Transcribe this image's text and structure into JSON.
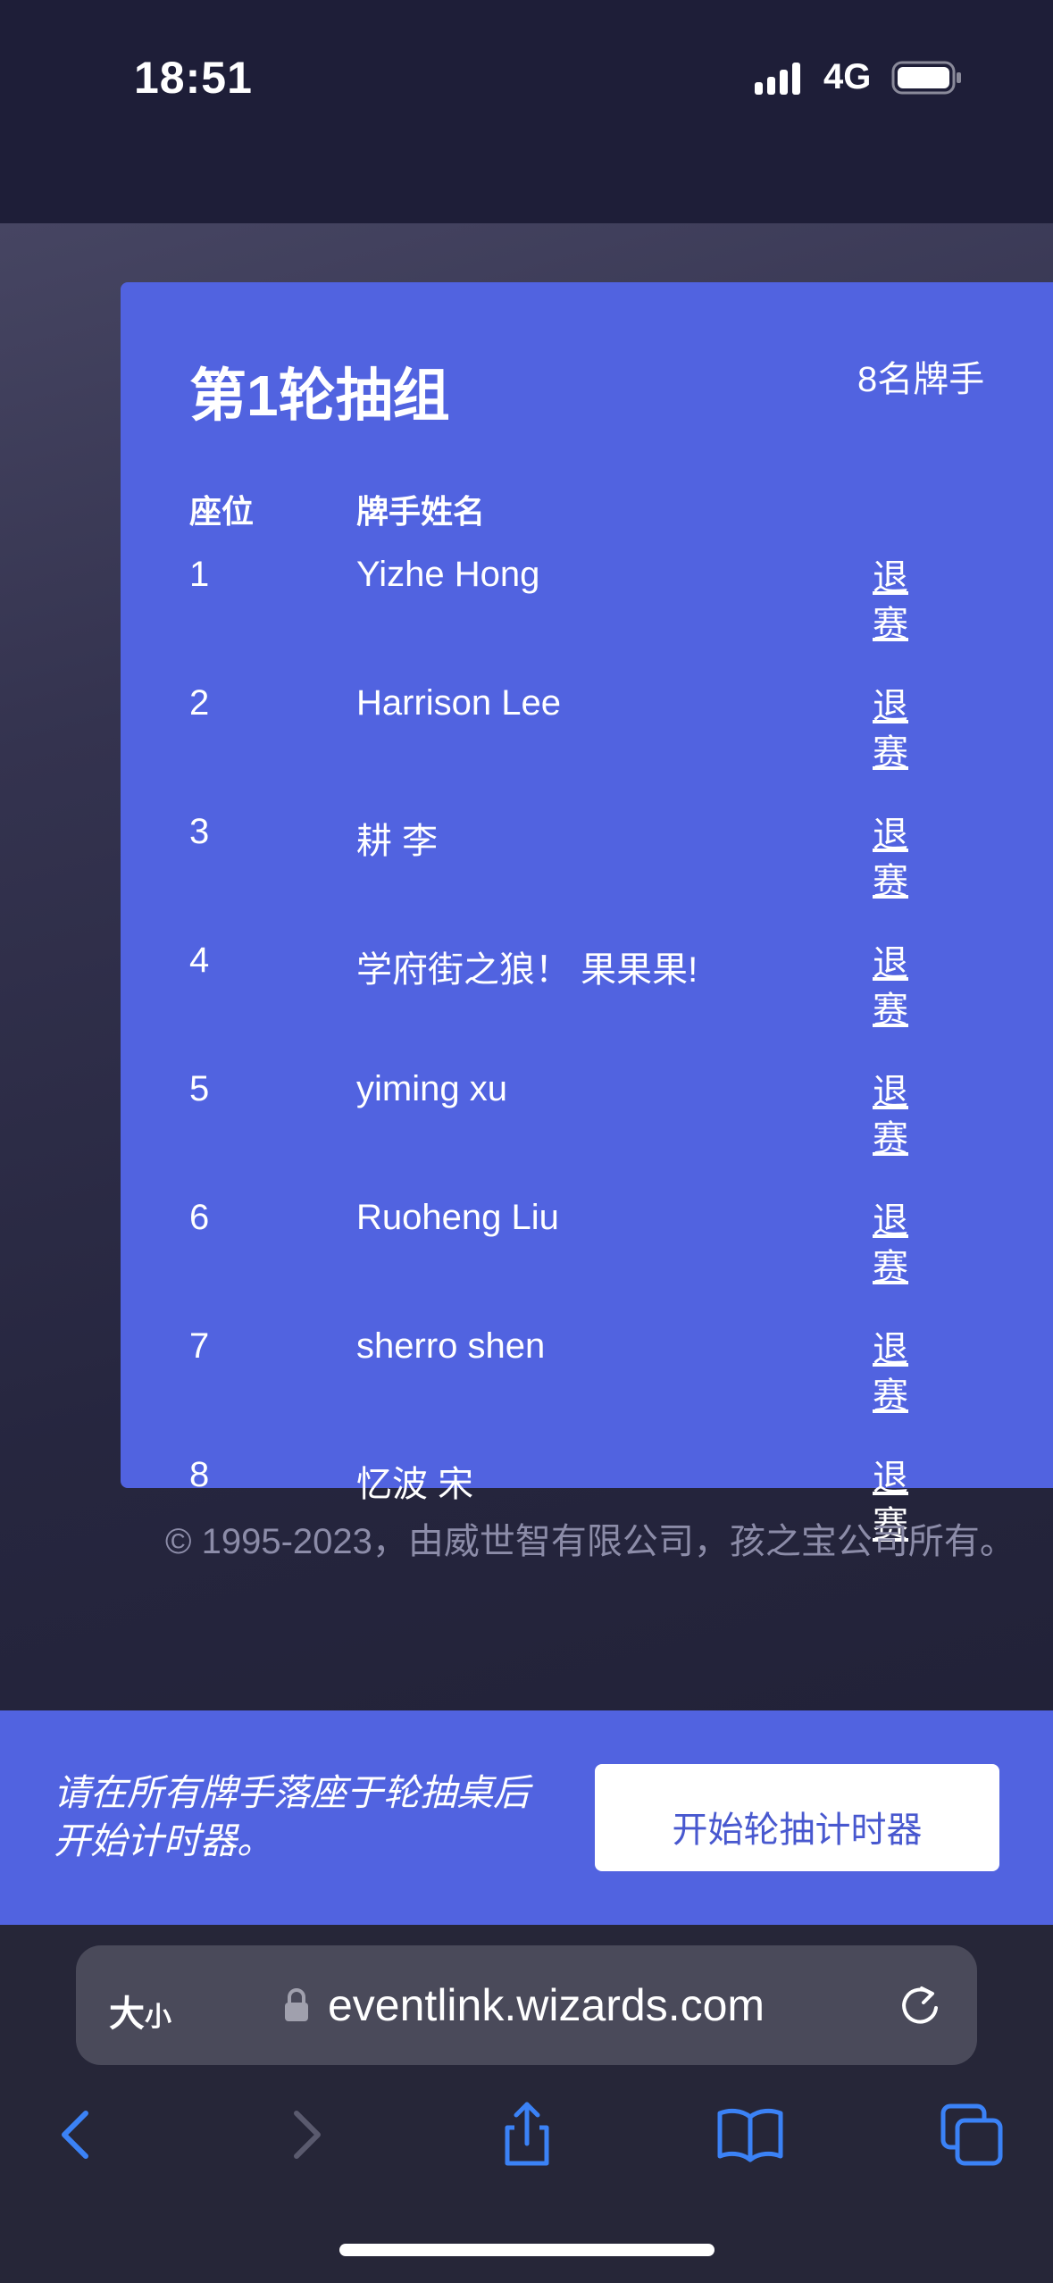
{
  "status_bar": {
    "time": "18:51",
    "network": "4G"
  },
  "card": {
    "title": "第1轮抽组",
    "player_count": "8名牌手",
    "columns": {
      "seat": "座位",
      "name": "牌手姓名"
    },
    "rows": [
      {
        "seat": "1",
        "name": "Yizhe Hong",
        "action": "退赛"
      },
      {
        "seat": "2",
        "name": "Harrison Lee",
        "action": "退赛"
      },
      {
        "seat": "3",
        "name": "耕 李",
        "action": "退赛"
      },
      {
        "seat": "4",
        "name": "学府街之狼！ 果果果!",
        "action": "退赛"
      },
      {
        "seat": "5",
        "name": "yiming xu",
        "action": "退赛"
      },
      {
        "seat": "6",
        "name": "Ruoheng Liu",
        "action": "退赛"
      },
      {
        "seat": "7",
        "name": "sherro shen",
        "action": "退赛"
      },
      {
        "seat": "8",
        "name": "忆波 宋",
        "action": "退赛"
      }
    ]
  },
  "footer": {
    "copyright": "© 1995-2023，由威世智有限公司，孩之宝公司所有。"
  },
  "bottom_bar": {
    "instruction": "请在所有牌手落座于轮抽桌后开始计时器。",
    "start_button": "开始轮抽计时器"
  },
  "browser": {
    "text_size_big": "大",
    "text_size_small": "小",
    "url": "eventlink.wizards.com",
    "icons": [
      "lock-icon",
      "reload-icon",
      "back-icon",
      "forward-icon",
      "share-icon",
      "bookmarks-icon",
      "tabs-icon"
    ]
  },
  "colors": {
    "accent": "#5163e0",
    "button_text": "#4858cf",
    "ios_blue": "#3b82f6"
  }
}
